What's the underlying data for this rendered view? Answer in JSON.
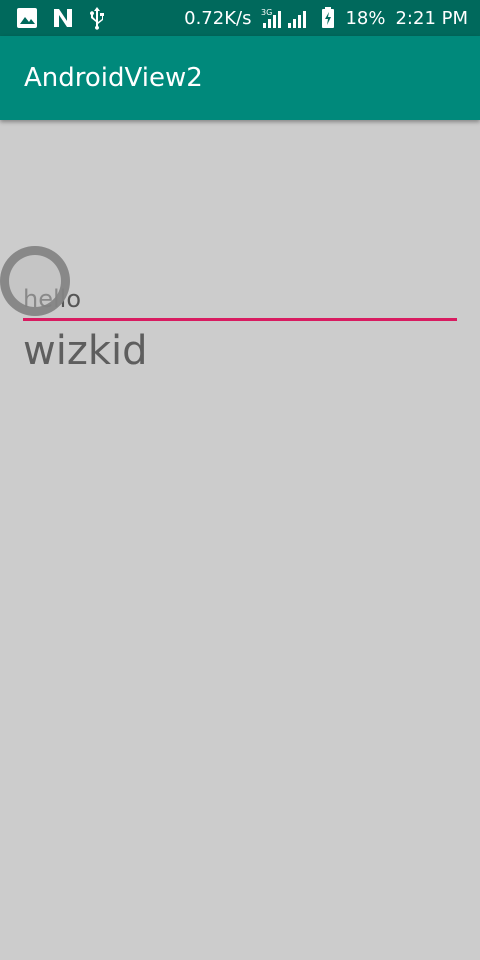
{
  "status_bar": {
    "left_icons": [
      "image-icon",
      "n-app-icon",
      "usb-icon"
    ],
    "network_speed": "0.72K/s",
    "network_type": "3G",
    "battery_percent": "18%",
    "time": "2:21 PM"
  },
  "toolbar": {
    "title": "AndroidView2"
  },
  "edit_text": {
    "value": "hello",
    "underline_color": "#d81b60"
  },
  "text_view": {
    "text": "wizkid"
  },
  "colors": {
    "status_bar": "#00695c",
    "toolbar": "#00897b",
    "background": "#cccccc",
    "accent": "#d81b60"
  }
}
